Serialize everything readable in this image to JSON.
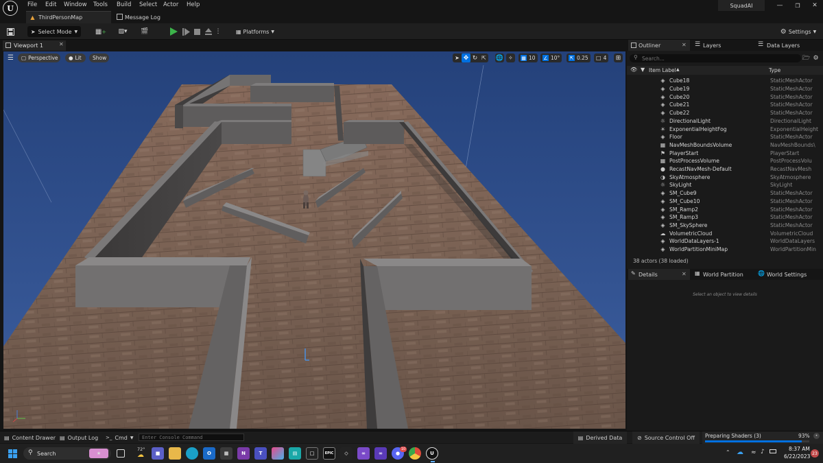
{
  "menu": [
    "File",
    "Edit",
    "Window",
    "Tools",
    "Build",
    "Select",
    "Actor",
    "Help"
  ],
  "project_name": "SquadAI",
  "tabs": {
    "map": "ThirdPersonMap",
    "message_log": "Message Log"
  },
  "toolbar": {
    "select_mode": "Select Mode",
    "platforms": "Platforms",
    "settings": "Settings"
  },
  "viewport": {
    "tab_label": "Viewport 1",
    "perspective": "Perspective",
    "lit": "Lit",
    "show": "Show",
    "grid_snap": "10",
    "rotation_snap": "10°",
    "scale_snap": "0.25",
    "camera_speed": "4"
  },
  "outliner": {
    "tabs": [
      "Outliner",
      "Layers",
      "Data Layers"
    ],
    "search_placeholder": "Search...",
    "col_label": "Item Label",
    "col_type": "Type",
    "items": [
      {
        "name": "Cube18",
        "type": "StaticMeshActor",
        "icon": "static-mesh-icon"
      },
      {
        "name": "Cube19",
        "type": "StaticMeshActor",
        "icon": "static-mesh-icon"
      },
      {
        "name": "Cube20",
        "type": "StaticMeshActor",
        "icon": "static-mesh-icon"
      },
      {
        "name": "Cube21",
        "type": "StaticMeshActor",
        "icon": "static-mesh-icon"
      },
      {
        "name": "Cube22",
        "type": "StaticMeshActor",
        "icon": "static-mesh-icon"
      },
      {
        "name": "DirectionalLight",
        "type": "DirectionalLight",
        "icon": "directional-light-icon"
      },
      {
        "name": "ExponentialHeightFog",
        "type": "ExponentialHeight",
        "icon": "fog-icon"
      },
      {
        "name": "Floor",
        "type": "StaticMeshActor",
        "icon": "static-mesh-icon"
      },
      {
        "name": "NavMeshBoundsVolume",
        "type": "NavMeshBounds\\",
        "icon": "volume-icon"
      },
      {
        "name": "PlayerStart",
        "type": "PlayerStart",
        "icon": "player-start-icon"
      },
      {
        "name": "PostProcessVolume",
        "type": "PostProcessVolu",
        "icon": "volume-icon"
      },
      {
        "name": "RecastNavMesh-Default",
        "type": "RecastNavMesh",
        "icon": "navmesh-icon"
      },
      {
        "name": "SkyAtmosphere",
        "type": "SkyAtmosphere",
        "icon": "sky-atmosphere-icon"
      },
      {
        "name": "SkyLight",
        "type": "SkyLight",
        "icon": "sky-light-icon"
      },
      {
        "name": "SM_Cube9",
        "type": "StaticMeshActor",
        "icon": "static-mesh-icon"
      },
      {
        "name": "SM_Cube10",
        "type": "StaticMeshActor",
        "icon": "static-mesh-icon"
      },
      {
        "name": "SM_Ramp2",
        "type": "StaticMeshActor",
        "icon": "static-mesh-icon"
      },
      {
        "name": "SM_Ramp3",
        "type": "StaticMeshActor",
        "icon": "static-mesh-icon"
      },
      {
        "name": "SM_SkySphere",
        "type": "StaticMeshActor",
        "icon": "static-mesh-icon"
      },
      {
        "name": "VolumetricCloud",
        "type": "VolumetricCloud",
        "icon": "cloud-icon"
      },
      {
        "name": "WorldDataLayers-1",
        "type": "WorldDataLayers",
        "icon": "world-data-layers-icon"
      },
      {
        "name": "WorldPartitionMiniMap",
        "type": "WorldPartitionMin",
        "icon": "minimap-icon"
      }
    ],
    "actor_count": "38 actors (38 loaded)"
  },
  "details": {
    "tabs": [
      "Details",
      "World Partition",
      "World Settings"
    ],
    "empty_message": "Select an object to view details"
  },
  "bottom_bar": {
    "content_drawer": "Content Drawer",
    "output_log": "Output Log",
    "cmd": "Cmd",
    "console_placeholder": "Enter Console Command",
    "derived_data": "Derived Data",
    "source_control": "Source Control Off",
    "shaders_label": "Preparing Shaders (3)",
    "shaders_percent": "93%",
    "shaders_progress": 0.93
  },
  "taskbar": {
    "search": "Search",
    "weather_temp": "72°",
    "time": "8:37 AM",
    "date": "6/22/2023",
    "notification_count": "23",
    "discord_badge": "10"
  },
  "colors": {
    "accent": "#0070e0",
    "sky": "#2e4f87",
    "floor": "#7b6356",
    "wall": "#6d6b6a",
    "play": "#3cb34a"
  }
}
